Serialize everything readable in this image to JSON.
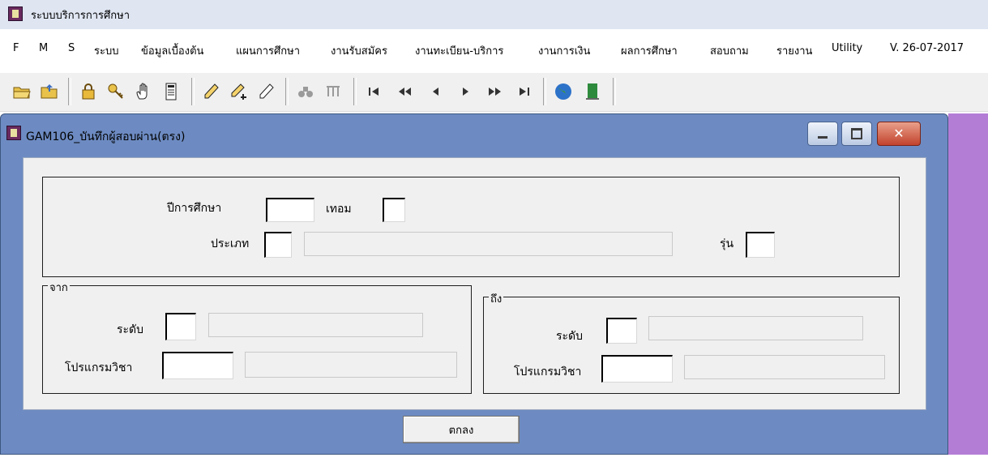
{
  "app": {
    "title": "ระบบบริการการศึกษา"
  },
  "menu": {
    "items": [
      "F",
      "M",
      "S",
      "ระบบ",
      "ข้อมูลเบื้องต้น",
      "แผนการศึกษา",
      "งานรับสมัคร",
      "งานทะเบียน-บริการ",
      "งานการเงิน",
      "ผลการศึกษา",
      "สอบถาม",
      "รายงาน",
      "Utility",
      "V. 26-07-2017"
    ]
  },
  "toolbar": {
    "icons": [
      "open-folder-icon",
      "upload-folder-icon",
      "lock-icon",
      "keys-icon",
      "hand-icon",
      "document-icon",
      "pencil-icon",
      "pencil-add-icon",
      "pencil-edit-icon",
      "binoculars-icon",
      "filter-icon",
      "first-record-icon",
      "rewind-icon",
      "previous-icon",
      "next-icon",
      "fast-forward-icon",
      "last-record-icon",
      "globe-icon",
      "exit-door-icon"
    ]
  },
  "window": {
    "title": "GAM106_บันทึกผู้สอบผ่าน(ตรง)",
    "close_glyph": "✕"
  },
  "form": {
    "academic_year_label": "ปีการศึกษา",
    "academic_year_value": "",
    "term_label": "เทอม",
    "term_value": "",
    "type_label": "ประเภท",
    "type_code": "",
    "type_name": "",
    "batch_label": "รุ่น",
    "batch_value": "",
    "from": {
      "legend": "จาก",
      "level_label": "ระดับ",
      "level_code": "",
      "level_name": "",
      "program_label": "โปรแกรมวิชา",
      "program_code": "",
      "program_name": ""
    },
    "to": {
      "legend": "ถึง",
      "level_label": "ระดับ",
      "level_code": "",
      "level_name": "",
      "program_label": "โปรแกรมวิชา",
      "program_code": "",
      "program_name": ""
    },
    "ok_label": "ตกลง"
  },
  "colors": {
    "window_body": "#6d8bc2",
    "right_strip": "#b37dd6",
    "close_button": "#c2422c"
  }
}
